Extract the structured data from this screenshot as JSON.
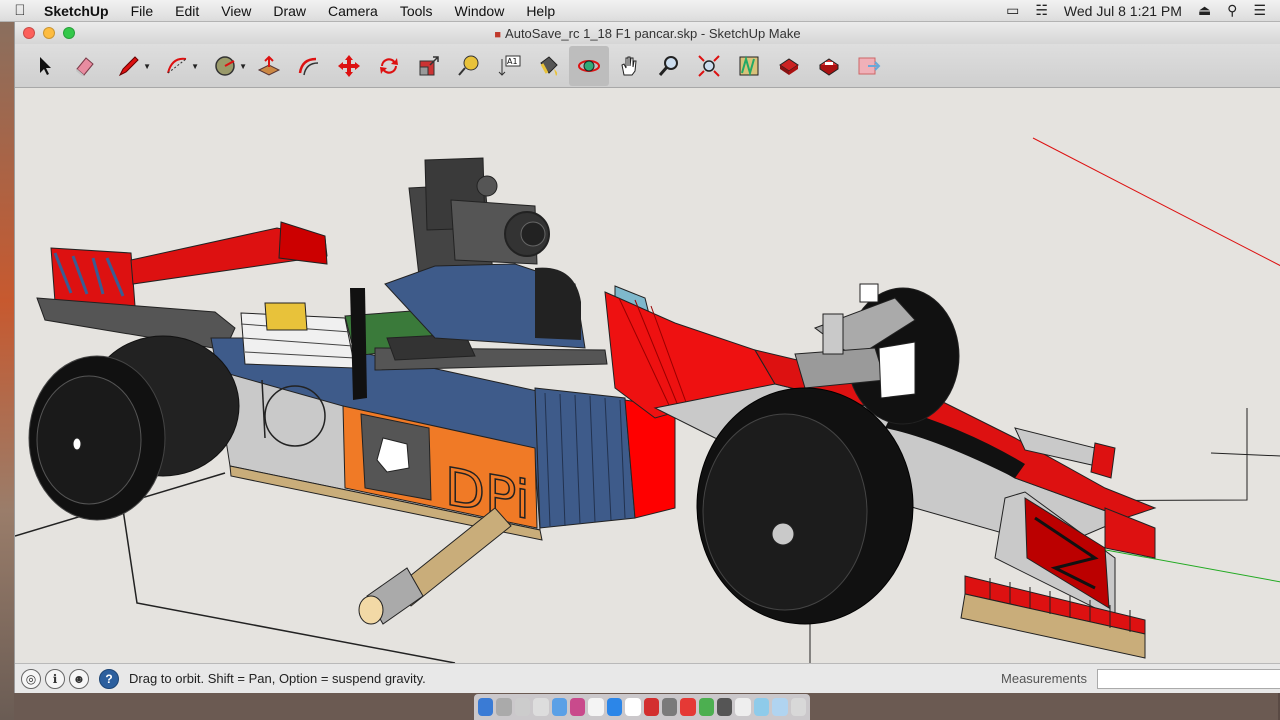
{
  "menubar": {
    "apple_icon": "apple-icon",
    "app_name": "SketchUp",
    "items": [
      "File",
      "Edit",
      "View",
      "Draw",
      "Camera",
      "Tools",
      "Window",
      "Help"
    ],
    "clock": "Wed Jul 8  1:21 PM"
  },
  "window": {
    "title": "AutoSave_rc 1_18 F1 pancar.skp - SketchUp Make"
  },
  "toolbar": {
    "tools": [
      {
        "name": "select-tool",
        "icon": "arrow-icon"
      },
      {
        "name": "eraser-tool",
        "icon": "eraser-icon"
      },
      {
        "name": "line-tool",
        "icon": "pencil-icon"
      },
      {
        "name": "arc-tool",
        "icon": "arc-icon"
      },
      {
        "name": "shapes-tool",
        "icon": "circle-icon"
      },
      {
        "name": "push-pull-tool",
        "icon": "push-pull-icon"
      },
      {
        "name": "offset-tool",
        "icon": "offset-icon"
      },
      {
        "name": "move-tool",
        "icon": "move-icon"
      },
      {
        "name": "rotate-tool",
        "icon": "rotate-icon"
      },
      {
        "name": "scale-tool",
        "icon": "scale-icon"
      },
      {
        "name": "tape-measure-tool",
        "icon": "tape-icon"
      },
      {
        "name": "text-tool",
        "icon": "text-icon"
      },
      {
        "name": "paint-bucket-tool",
        "icon": "bucket-icon"
      },
      {
        "name": "orbit-tool",
        "icon": "orbit-icon"
      },
      {
        "name": "pan-tool",
        "icon": "hand-icon"
      },
      {
        "name": "zoom-tool",
        "icon": "magnifier-icon"
      },
      {
        "name": "zoom-extents-tool",
        "icon": "zoom-extents-icon"
      },
      {
        "name": "warehouse-tool",
        "icon": "warehouse-icon"
      },
      {
        "name": "extension-warehouse-tool",
        "icon": "extension-icon"
      },
      {
        "name": "sketchup-models-tool",
        "icon": "models-icon"
      },
      {
        "name": "send-to-layout-tool",
        "icon": "layout-icon"
      }
    ],
    "text_tool_label": "A1",
    "active_tool": "orbit-tool"
  },
  "model": {
    "car_logo": "DPi",
    "front_wing_letters": "M M"
  },
  "statusbar": {
    "hint": "Drag to orbit. Shift = Pan, Option = suspend gravity.",
    "measurements_label": "Measurements",
    "measurements_value": ""
  },
  "colors": {
    "accent_red": "#ff0000",
    "body_blue": "#3e5b8a",
    "logo_orange": "#f07a26",
    "body_gray": "#c9c9c9",
    "help_blue": "#2c5f9e"
  }
}
